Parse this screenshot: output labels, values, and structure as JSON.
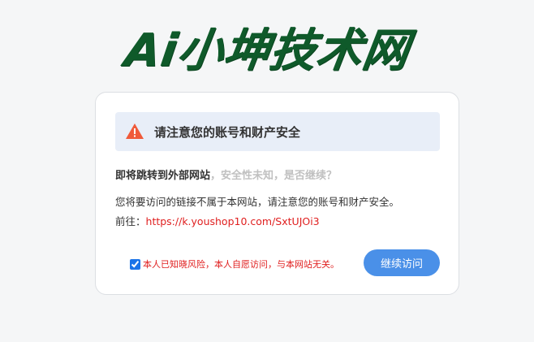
{
  "logo": {
    "text": "Ai小坤技术网",
    "color": "#0f5a2a"
  },
  "alert": {
    "icon": "warning-triangle-icon",
    "text": "请注意您的账号和财产安全",
    "icon_color": "#f05a3a"
  },
  "notice": {
    "headline_strong": "即将跳转到外部网站",
    "headline_muted": "，安全性未知，是否继续？",
    "description": "您将要访问的链接不属于本网站，请注意您的账号和财产安全。",
    "target_label": "前往：",
    "target_url": "https://k.youshop10.com/SxtUJOi3"
  },
  "consent": {
    "checked": true,
    "label": "本人已知晓风险，本人自愿访问，与本网站无关。"
  },
  "actions": {
    "continue_label": "继续访问",
    "button_color": "#4a90e8"
  }
}
